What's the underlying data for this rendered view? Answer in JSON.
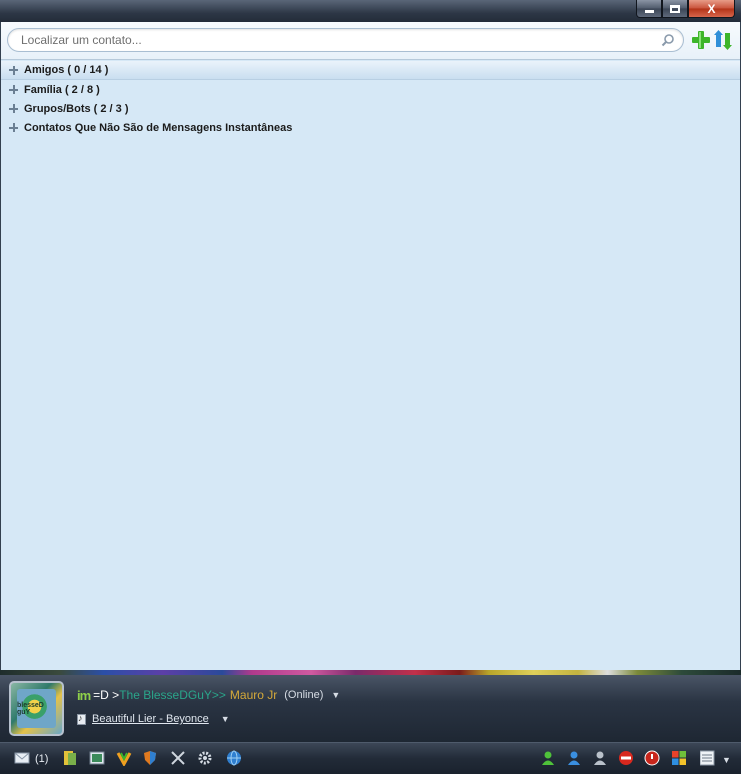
{
  "window": {
    "controls": {
      "minimize": "minimize",
      "maximize": "maximize",
      "close": "X"
    }
  },
  "search": {
    "placeholder": "Localizar um contato...",
    "value": ""
  },
  "groups": [
    {
      "label": "Amigos ( 0 / 14 )",
      "expanded": false
    },
    {
      "label": "Família ( 2 / 8 )",
      "expanded": false
    },
    {
      "label": "Grupos/Bots ( 2 / 3 )",
      "expanded": false
    },
    {
      "label": "Contatos Que Não São de Mensagens Instantâneas",
      "expanded": false
    }
  ],
  "user": {
    "avatar_text": "blesseD guY",
    "im_tag": "im",
    "nick_prefix": "=D >",
    "nick_main": "The BlesseDGuY>>",
    "nick_suffix": "Mauro Jr",
    "status": "(Online)",
    "personal_message": "Beautiful Lier - Beyonce"
  },
  "bottombar": {
    "mail_count": "(1)"
  },
  "colors": {
    "list_background": "#d6e8f6",
    "titlebar": "#2d3746",
    "nick_teal": "#2aa58a",
    "nick_gold": "#d4a93a"
  }
}
